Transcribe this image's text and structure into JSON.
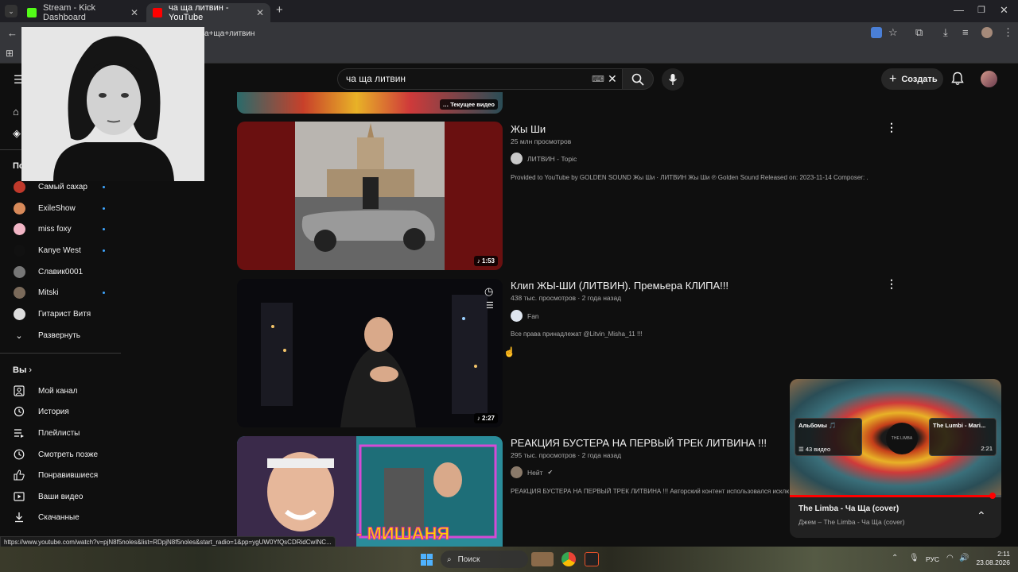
{
  "browser": {
    "tabs": [
      {
        "title": "Stream - Kick Dashboard",
        "favicon_color": "#53fc18"
      },
      {
        "title": "ча ща литвин - YouTube",
        "favicon_color": "#ff0000"
      }
    ],
    "new_tab_label": "+",
    "url_fragment": "а+ща+литвин"
  },
  "youtube": {
    "search": {
      "query": "ча ща литвин"
    },
    "create_label": "Создать",
    "current_video_badge": "Текущее видео",
    "sidebar": {
      "subscriptions_title": "По",
      "channels": [
        {
          "name": "Самый сахар",
          "color": "#c0392b",
          "has_dot": true
        },
        {
          "name": "ExileShow",
          "color": "#d88a5a",
          "has_dot": true
        },
        {
          "name": "miss foxy",
          "color": "#f2b6c6",
          "has_dot": true
        },
        {
          "name": "Kanye West",
          "color": "#111111",
          "has_dot": true
        },
        {
          "name": "Славик0001",
          "color": "#777777",
          "has_dot": false
        },
        {
          "name": "Mitski",
          "color": "#7a6a5a",
          "has_dot": true
        },
        {
          "name": "Гитарист Витя",
          "color": "#dddddd",
          "has_dot": false
        }
      ],
      "expand_label": "Развернуть",
      "you_title": "Вы",
      "you_items": [
        {
          "label": "Мой канал",
          "icon": "channel-icon"
        },
        {
          "label": "История",
          "icon": "history-icon"
        },
        {
          "label": "Плейлисты",
          "icon": "playlists-icon"
        },
        {
          "label": "Смотреть позже",
          "icon": "watch-later-icon"
        },
        {
          "label": "Понравившиеся",
          "icon": "like-icon"
        },
        {
          "label": "Ваши видео",
          "icon": "your-videos-icon"
        },
        {
          "label": "Скачанные",
          "icon": "download-icon"
        }
      ]
    },
    "results": [
      {
        "title": "Жы Ши",
        "meta": "25 млн просмотров",
        "channel": "ЛИТВИН - Topic",
        "description": "Provided to YouTube by GOLDEN SOUND Жы Ши · ЛИТВИН Жы Ши ℗ Golden Sound Released on: 2023-11-14 Composer: ...",
        "duration": "1:53"
      },
      {
        "title": "Клип ЖЫ-ШИ (ЛИТВИН). Премьера КЛИПА!!!",
        "meta": "438 тыс. просмотров · 2 года назад",
        "channel": "Fan",
        "description": "Все права принадлежат @Litvin_Misha_11 !!!",
        "duration": "2:27"
      },
      {
        "title": "РЕАКЦИЯ БУСТЕРА НА ПЕРВЫЙ ТРЕК ЛИТВИНА !!!",
        "meta": "295 тыс. просмотров · 2 года назад",
        "channel": "Нейт",
        "description": "РЕАКЦИЯ БУСТЕРА НА ПЕРВЫЙ ТРЕК ЛИТВИНА !!! Авторский контент использовался исклю",
        "thumb_text": "- МИШАНЯ"
      }
    ],
    "miniplayer": {
      "title": "The Limba - Ча Ща (cover)",
      "subtitle": "Джем – The Limba - Ча Ща (cover)",
      "card_left_title": "Альбомы 🎵",
      "card_left_count": "43 видео",
      "card_right_title": "The Lumbi - Mari...",
      "card_right_duration": "2:21",
      "progress": 0.96
    }
  },
  "status_url": "https://www.youtube.com/watch?v=pjN8f5noles&list=RDpjN8f5noles&start_radio=1&pp=ygUW0YfQsCDRidCwINC...",
  "taskbar": {
    "search_label": "Поиск",
    "lang": "РУС",
    "time": "2:11",
    "date": "23.08.2026"
  }
}
